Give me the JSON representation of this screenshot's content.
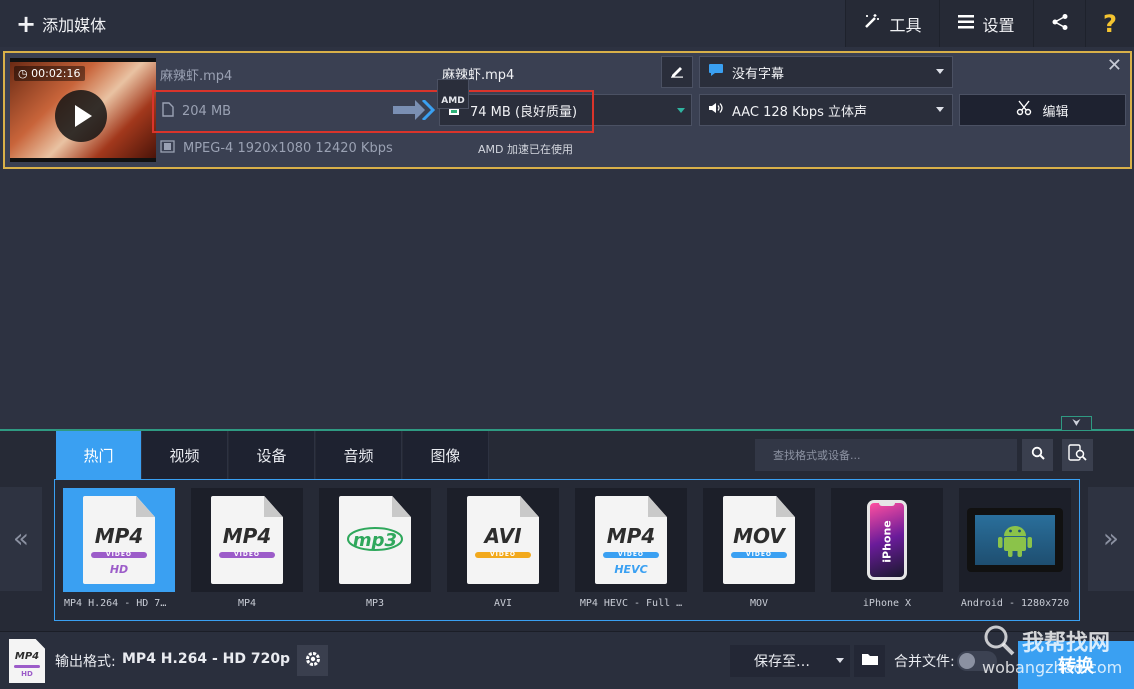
{
  "toolbar": {
    "add_media": "添加媒体",
    "tools": "工具",
    "settings": "设置"
  },
  "file": {
    "duration": "00:02:16",
    "source_name": "麻辣虾.mp4",
    "source_size": "204 MB",
    "source_codec": "MPEG-4 1920x1080 12420 Kbps",
    "output_name": "麻辣虾.mp4",
    "output_size": "74 MB (良好质量)",
    "subtitle": "没有字幕",
    "audio": "AAC 128 Kbps 立体声",
    "edit_label": "编辑",
    "amd_badge": "AMD",
    "amd_text": "AMD 加速已在使用"
  },
  "tabs": [
    {
      "label": "热门",
      "active": true
    },
    {
      "label": "视频"
    },
    {
      "label": "设备"
    },
    {
      "label": "音频"
    },
    {
      "label": "图像"
    }
  ],
  "search": {
    "placeholder": "查找格式或设备..."
  },
  "formats": [
    {
      "label": "MP4 H.264 - HD 7…",
      "icon": "MP4",
      "sub": "HD",
      "active": true
    },
    {
      "label": "MP4",
      "icon": "MP4"
    },
    {
      "label": "MP3",
      "icon": "mp3"
    },
    {
      "label": "AVI",
      "icon": "AVI"
    },
    {
      "label": "MP4 HEVC - Full …",
      "icon": "MP4",
      "sub": "HEVC"
    },
    {
      "label": "MOV",
      "icon": "MOV"
    },
    {
      "label": "iPhone X",
      "icon": "iPhone"
    },
    {
      "label": "Android - 1280x720",
      "icon": "android"
    }
  ],
  "bottom": {
    "output_label": "输出格式:",
    "output_value": "MP4 H.264 - HD 720p",
    "save_to": "保存至…",
    "merge": "合并文件:",
    "convert": "转换",
    "thumb_title": "MP4",
    "thumb_sub": "HD"
  },
  "watermark": {
    "line1": "我帮找网",
    "line2": "wobangzhao.com"
  },
  "colors": {
    "accent": "#3aa0f2",
    "highlight_border": "#d8b049",
    "red_box": "#d9342b"
  }
}
